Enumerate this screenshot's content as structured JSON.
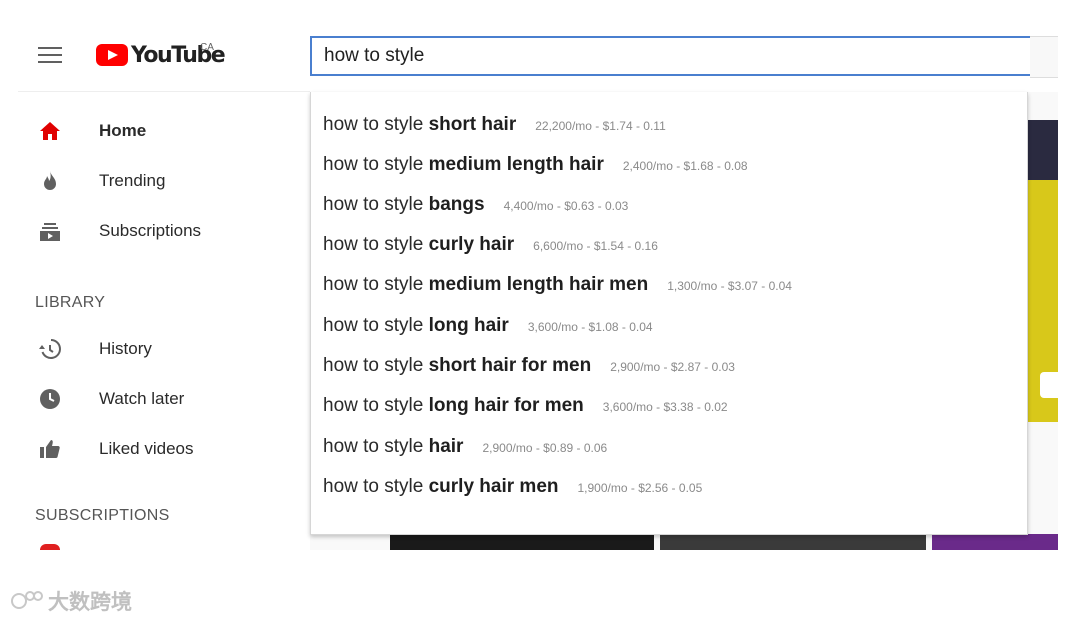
{
  "header": {
    "logo_text": "YouTube",
    "country": "CA",
    "search_value": "how to style"
  },
  "sidebar": {
    "items": [
      {
        "label": "Home",
        "icon": "home-icon"
      },
      {
        "label": "Trending",
        "icon": "fire-icon"
      },
      {
        "label": "Subscriptions",
        "icon": "subscriptions-icon"
      }
    ],
    "library_heading": "LIBRARY",
    "library_items": [
      {
        "label": "History",
        "icon": "history-icon"
      },
      {
        "label": "Watch later",
        "icon": "clock-icon"
      },
      {
        "label": "Liked videos",
        "icon": "thumbs-up-icon"
      }
    ],
    "subscriptions_heading": "SUBSCRIPTIONS"
  },
  "suggestions": [
    {
      "prefix": "how to style ",
      "bold": "short hair",
      "meta": "22,200/mo - $1.74 - 0.11"
    },
    {
      "prefix": "how to style ",
      "bold": "medium length hair",
      "meta": "2,400/mo - $1.68 - 0.08"
    },
    {
      "prefix": "how to style ",
      "bold": "bangs",
      "meta": "4,400/mo - $0.63 - 0.03"
    },
    {
      "prefix": "how to style ",
      "bold": "curly hair",
      "meta": "6,600/mo - $1.54 - 0.16"
    },
    {
      "prefix": "how to style ",
      "bold": "medium length hair men",
      "meta": "1,300/mo - $3.07 - 0.04"
    },
    {
      "prefix": "how to style ",
      "bold": "long hair",
      "meta": "3,600/mo - $1.08 - 0.04"
    },
    {
      "prefix": "how to style ",
      "bold": "short hair for men",
      "meta": "2,900/mo - $2.87 - 0.03"
    },
    {
      "prefix": "how to style ",
      "bold": "long hair for men",
      "meta": "3,600/mo - $3.38 - 0.02"
    },
    {
      "prefix": "how to style ",
      "bold": "hair",
      "meta": "2,900/mo - $0.89 - 0.06"
    },
    {
      "prefix": "how to style ",
      "bold": "curly hair men",
      "meta": "1,900/mo - $2.56 - 0.05"
    }
  ],
  "watermark": "大数跨境",
  "colors": {
    "accent": "#ff0000",
    "search_border": "#4a7fcf"
  }
}
